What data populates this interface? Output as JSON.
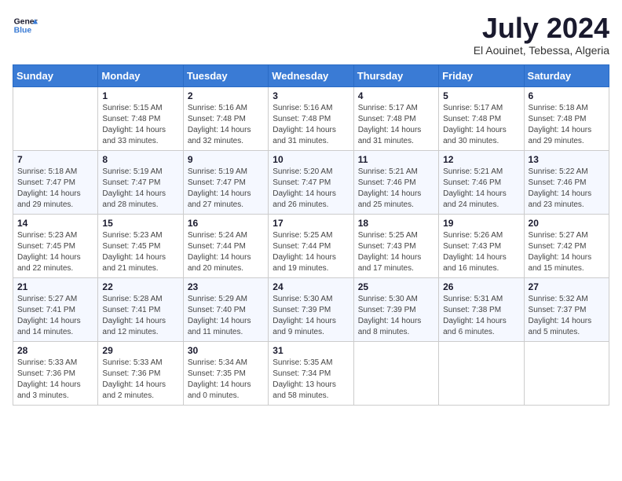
{
  "logo": {
    "text1": "General",
    "text2": "Blue"
  },
  "title": "July 2024",
  "location": "El Aouinet, Tebessa, Algeria",
  "days_of_week": [
    "Sunday",
    "Monday",
    "Tuesday",
    "Wednesday",
    "Thursday",
    "Friday",
    "Saturday"
  ],
  "weeks": [
    [
      {
        "day": "",
        "sunrise": "",
        "sunset": "",
        "daylight": ""
      },
      {
        "day": "1",
        "sunrise": "Sunrise: 5:15 AM",
        "sunset": "Sunset: 7:48 PM",
        "daylight": "Daylight: 14 hours and 33 minutes."
      },
      {
        "day": "2",
        "sunrise": "Sunrise: 5:16 AM",
        "sunset": "Sunset: 7:48 PM",
        "daylight": "Daylight: 14 hours and 32 minutes."
      },
      {
        "day": "3",
        "sunrise": "Sunrise: 5:16 AM",
        "sunset": "Sunset: 7:48 PM",
        "daylight": "Daylight: 14 hours and 31 minutes."
      },
      {
        "day": "4",
        "sunrise": "Sunrise: 5:17 AM",
        "sunset": "Sunset: 7:48 PM",
        "daylight": "Daylight: 14 hours and 31 minutes."
      },
      {
        "day": "5",
        "sunrise": "Sunrise: 5:17 AM",
        "sunset": "Sunset: 7:48 PM",
        "daylight": "Daylight: 14 hours and 30 minutes."
      },
      {
        "day": "6",
        "sunrise": "Sunrise: 5:18 AM",
        "sunset": "Sunset: 7:48 PM",
        "daylight": "Daylight: 14 hours and 29 minutes."
      }
    ],
    [
      {
        "day": "7",
        "sunrise": "Sunrise: 5:18 AM",
        "sunset": "Sunset: 7:47 PM",
        "daylight": "Daylight: 14 hours and 29 minutes."
      },
      {
        "day": "8",
        "sunrise": "Sunrise: 5:19 AM",
        "sunset": "Sunset: 7:47 PM",
        "daylight": "Daylight: 14 hours and 28 minutes."
      },
      {
        "day": "9",
        "sunrise": "Sunrise: 5:19 AM",
        "sunset": "Sunset: 7:47 PM",
        "daylight": "Daylight: 14 hours and 27 minutes."
      },
      {
        "day": "10",
        "sunrise": "Sunrise: 5:20 AM",
        "sunset": "Sunset: 7:47 PM",
        "daylight": "Daylight: 14 hours and 26 minutes."
      },
      {
        "day": "11",
        "sunrise": "Sunrise: 5:21 AM",
        "sunset": "Sunset: 7:46 PM",
        "daylight": "Daylight: 14 hours and 25 minutes."
      },
      {
        "day": "12",
        "sunrise": "Sunrise: 5:21 AM",
        "sunset": "Sunset: 7:46 PM",
        "daylight": "Daylight: 14 hours and 24 minutes."
      },
      {
        "day": "13",
        "sunrise": "Sunrise: 5:22 AM",
        "sunset": "Sunset: 7:46 PM",
        "daylight": "Daylight: 14 hours and 23 minutes."
      }
    ],
    [
      {
        "day": "14",
        "sunrise": "Sunrise: 5:23 AM",
        "sunset": "Sunset: 7:45 PM",
        "daylight": "Daylight: 14 hours and 22 minutes."
      },
      {
        "day": "15",
        "sunrise": "Sunrise: 5:23 AM",
        "sunset": "Sunset: 7:45 PM",
        "daylight": "Daylight: 14 hours and 21 minutes."
      },
      {
        "day": "16",
        "sunrise": "Sunrise: 5:24 AM",
        "sunset": "Sunset: 7:44 PM",
        "daylight": "Daylight: 14 hours and 20 minutes."
      },
      {
        "day": "17",
        "sunrise": "Sunrise: 5:25 AM",
        "sunset": "Sunset: 7:44 PM",
        "daylight": "Daylight: 14 hours and 19 minutes."
      },
      {
        "day": "18",
        "sunrise": "Sunrise: 5:25 AM",
        "sunset": "Sunset: 7:43 PM",
        "daylight": "Daylight: 14 hours and 17 minutes."
      },
      {
        "day": "19",
        "sunrise": "Sunrise: 5:26 AM",
        "sunset": "Sunset: 7:43 PM",
        "daylight": "Daylight: 14 hours and 16 minutes."
      },
      {
        "day": "20",
        "sunrise": "Sunrise: 5:27 AM",
        "sunset": "Sunset: 7:42 PM",
        "daylight": "Daylight: 14 hours and 15 minutes."
      }
    ],
    [
      {
        "day": "21",
        "sunrise": "Sunrise: 5:27 AM",
        "sunset": "Sunset: 7:41 PM",
        "daylight": "Daylight: 14 hours and 14 minutes."
      },
      {
        "day": "22",
        "sunrise": "Sunrise: 5:28 AM",
        "sunset": "Sunset: 7:41 PM",
        "daylight": "Daylight: 14 hours and 12 minutes."
      },
      {
        "day": "23",
        "sunrise": "Sunrise: 5:29 AM",
        "sunset": "Sunset: 7:40 PM",
        "daylight": "Daylight: 14 hours and 11 minutes."
      },
      {
        "day": "24",
        "sunrise": "Sunrise: 5:30 AM",
        "sunset": "Sunset: 7:39 PM",
        "daylight": "Daylight: 14 hours and 9 minutes."
      },
      {
        "day": "25",
        "sunrise": "Sunrise: 5:30 AM",
        "sunset": "Sunset: 7:39 PM",
        "daylight": "Daylight: 14 hours and 8 minutes."
      },
      {
        "day": "26",
        "sunrise": "Sunrise: 5:31 AM",
        "sunset": "Sunset: 7:38 PM",
        "daylight": "Daylight: 14 hours and 6 minutes."
      },
      {
        "day": "27",
        "sunrise": "Sunrise: 5:32 AM",
        "sunset": "Sunset: 7:37 PM",
        "daylight": "Daylight: 14 hours and 5 minutes."
      }
    ],
    [
      {
        "day": "28",
        "sunrise": "Sunrise: 5:33 AM",
        "sunset": "Sunset: 7:36 PM",
        "daylight": "Daylight: 14 hours and 3 minutes."
      },
      {
        "day": "29",
        "sunrise": "Sunrise: 5:33 AM",
        "sunset": "Sunset: 7:36 PM",
        "daylight": "Daylight: 14 hours and 2 minutes."
      },
      {
        "day": "30",
        "sunrise": "Sunrise: 5:34 AM",
        "sunset": "Sunset: 7:35 PM",
        "daylight": "Daylight: 14 hours and 0 minutes."
      },
      {
        "day": "31",
        "sunrise": "Sunrise: 5:35 AM",
        "sunset": "Sunset: 7:34 PM",
        "daylight": "Daylight: 13 hours and 58 minutes."
      },
      {
        "day": "",
        "sunrise": "",
        "sunset": "",
        "daylight": ""
      },
      {
        "day": "",
        "sunrise": "",
        "sunset": "",
        "daylight": ""
      },
      {
        "day": "",
        "sunrise": "",
        "sunset": "",
        "daylight": ""
      }
    ]
  ]
}
